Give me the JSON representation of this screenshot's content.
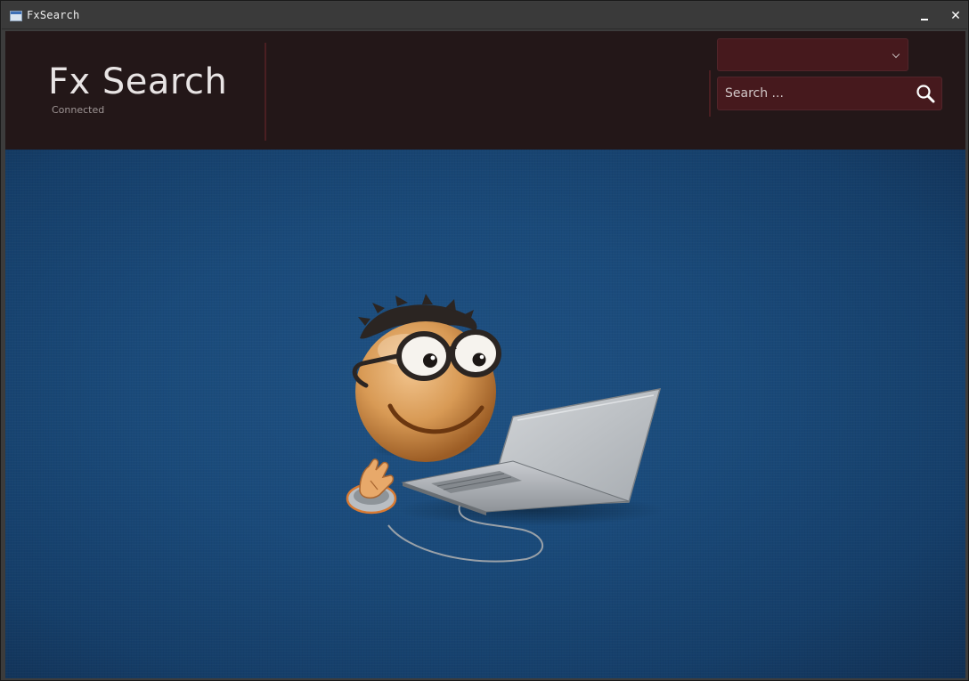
{
  "window": {
    "title": "FxSearch",
    "controls": {
      "minimize": "minimize",
      "close": "✕"
    }
  },
  "header": {
    "app_title": "Fx Search",
    "status": "Connected",
    "combo": {
      "value": ""
    },
    "search": {
      "placeholder": "Search ...",
      "value": ""
    }
  },
  "colors": {
    "header_bg": "#231718",
    "field_bg": "#46191d",
    "accent_divider": "#4a1f22",
    "main_bg": "#1a4a7a"
  },
  "icons": {
    "search": "search-icon",
    "combo_arrow": "chevron-down-icon",
    "app": "window-icon"
  },
  "main": {
    "illustration": "smiley-with-laptop"
  }
}
